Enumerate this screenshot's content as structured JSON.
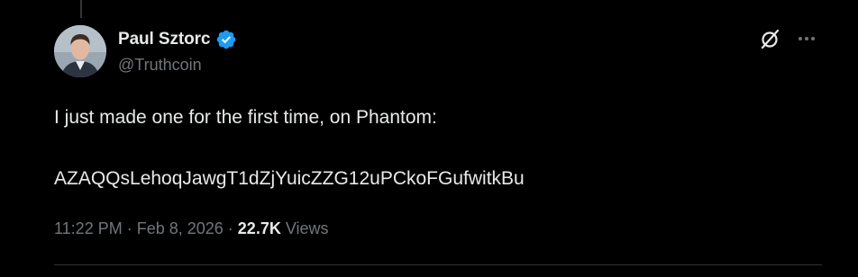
{
  "author": {
    "display_name": "Paul Sztorc",
    "handle": "@Truthcoin",
    "verified": true
  },
  "tweet": {
    "line1": "I just made one for the first time, on Phantom:",
    "line2": "AZAQQsLehoqJawgT1dZjYuicZZG12uPCkoFGufwitkBu"
  },
  "meta": {
    "time": "11:22 PM",
    "separator": "·",
    "date": "Feb 8, 2026",
    "views_count": "22.7K",
    "views_label": "Views"
  },
  "icons": {
    "verified": "verified-badge-icon",
    "grok": "grok-icon",
    "more": "more-options-icon"
  },
  "colors": {
    "background": "#000000",
    "text_primary": "#e7e9ea",
    "text_secondary": "#71767b",
    "verified_blue": "#1d9bf0",
    "divider": "#2f3336"
  }
}
